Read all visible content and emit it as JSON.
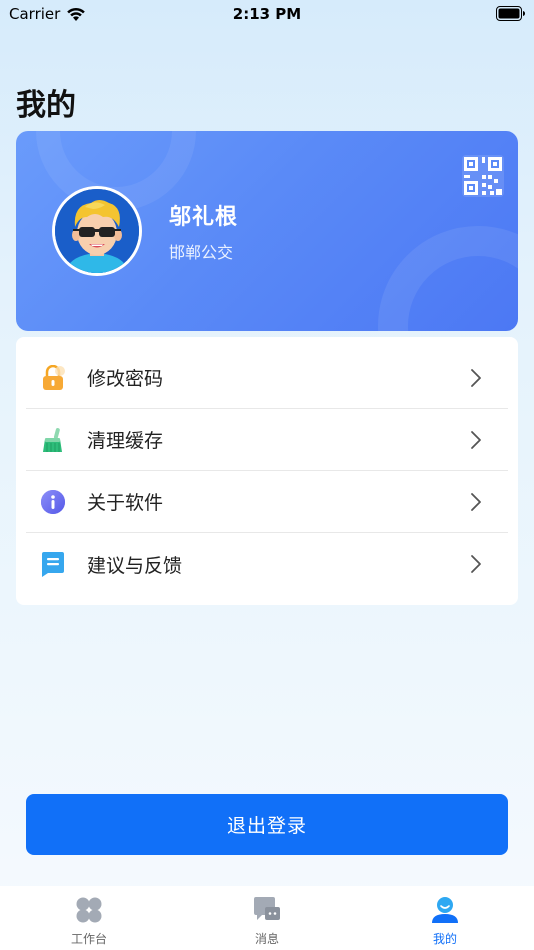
{
  "status_bar": {
    "carrier": "Carrier",
    "time": "2:13 PM"
  },
  "page": {
    "title": "我的"
  },
  "profile": {
    "name": "邬礼根",
    "organization": "邯郸公交"
  },
  "menu": {
    "items": [
      {
        "label": "修改密码",
        "icon": "lock-icon"
      },
      {
        "label": "清理缓存",
        "icon": "broom-icon"
      },
      {
        "label": "关于软件",
        "icon": "info-icon"
      },
      {
        "label": "建议与反馈",
        "icon": "feedback-icon"
      }
    ]
  },
  "logout": {
    "label": "退出登录"
  },
  "tab_bar": {
    "tabs": [
      {
        "label": "工作台",
        "icon": "workbench-icon",
        "active": false
      },
      {
        "label": "消息",
        "icon": "message-icon",
        "active": false
      },
      {
        "label": "我的",
        "icon": "profile-icon",
        "active": true
      }
    ]
  },
  "colors": {
    "accent": "#1170f8",
    "card_gradient_start": "#6a9bfb",
    "card_gradient_end": "#4c78f4"
  }
}
